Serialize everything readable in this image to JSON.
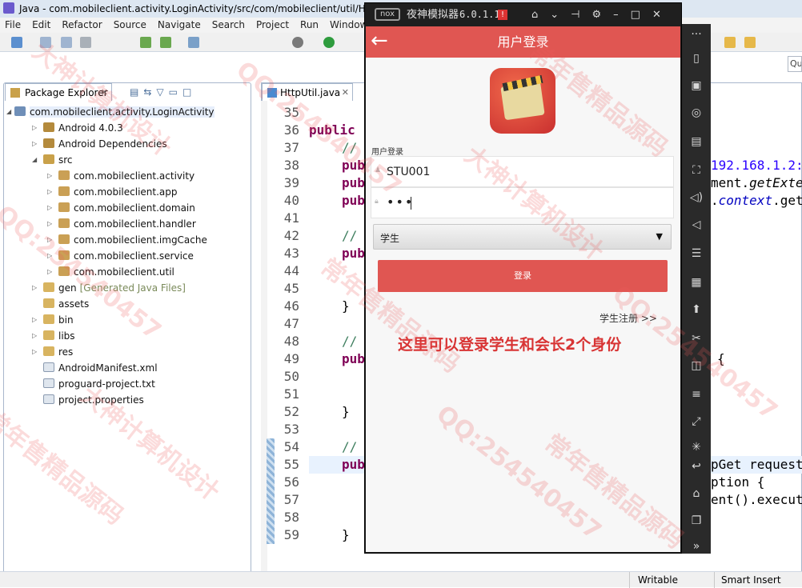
{
  "window": {
    "title": "Java - com.mobileclient.activity.LoginActivity/src/com/mobileclient/util/Htt"
  },
  "menu": [
    "File",
    "Edit",
    "Refactor",
    "Source",
    "Navigate",
    "Search",
    "Project",
    "Run",
    "Window"
  ],
  "package_explorer": {
    "tab": "Package Explorer",
    "project": "com.mobileclient.activity.LoginActivity",
    "items": [
      {
        "label": "Android 4.0.3",
        "icon": "library-icon"
      },
      {
        "label": "Android Dependencies",
        "icon": "library-icon"
      },
      {
        "label": "src",
        "icon": "source-folder-icon"
      },
      {
        "label": "com.mobileclient.activity",
        "icon": "package-icon"
      },
      {
        "label": "com.mobileclient.app",
        "icon": "package-icon"
      },
      {
        "label": "com.mobileclient.domain",
        "icon": "package-icon"
      },
      {
        "label": "com.mobileclient.handler",
        "icon": "package-icon"
      },
      {
        "label": "com.mobileclient.imgCache",
        "icon": "package-icon"
      },
      {
        "label": "com.mobileclient.service",
        "icon": "package-icon"
      },
      {
        "label": "com.mobileclient.util",
        "icon": "package-icon"
      },
      {
        "label": "gen",
        "suffix": "[Generated Java Files]",
        "icon": "folder-icon"
      },
      {
        "label": "assets",
        "icon": "folder-icon"
      },
      {
        "label": "bin",
        "icon": "folder-icon"
      },
      {
        "label": "libs",
        "icon": "folder-icon"
      },
      {
        "label": "res",
        "icon": "folder-icon"
      },
      {
        "label": "AndroidManifest.xml",
        "icon": "file-icon"
      },
      {
        "label": "proguard-project.txt",
        "icon": "file-icon"
      },
      {
        "label": "project.properties",
        "icon": "file-icon"
      }
    ]
  },
  "editor": {
    "tab": "HttpUtil.java",
    "line_numbers": [
      "35",
      "36",
      "37",
      "38",
      "39",
      "40",
      "41",
      "42",
      "43",
      "44",
      "45",
      "46",
      "47",
      "48",
      "49",
      "50",
      "51",
      "52",
      "53",
      "54",
      "55",
      "56",
      "57",
      "58",
      "59"
    ],
    "left_code": {
      "l36": "public",
      "comment": "//",
      "pub": "pub",
      "brace": "}"
    },
    "right_code": {
      "l38": "192.168.1.2:",
      "l39a": "ment.",
      "l39b": "getExte",
      "l40a": ".",
      "l40b": "context",
      "l40c": ".get",
      "l49": "{",
      "l55": "pGet request",
      "l56": "ption {",
      "l57": "ent().execut"
    }
  },
  "status": {
    "writable": "Writable",
    "insert_mode": "Smart Insert"
  },
  "emulator": {
    "brand": "nox",
    "name": "夜神模拟器",
    "version": "6.0.1.1",
    "badge": "!"
  },
  "app": {
    "header_title": "用户登录",
    "section_label": "用户登录",
    "username_value": "STU001",
    "password_value": "•••",
    "role_selected": "学生",
    "login_button": "登录",
    "register_link": "学生注册 >>",
    "annotation": "这里可以登录学生和会长2个身份"
  },
  "watermark": {
    "texts": [
      "大神计算机设计",
      "QQ:254540457",
      "常年售精品源码"
    ]
  },
  "colors": {
    "app_bar": "#e05652",
    "login_button": "#e05652",
    "annotation": "#d83434"
  }
}
